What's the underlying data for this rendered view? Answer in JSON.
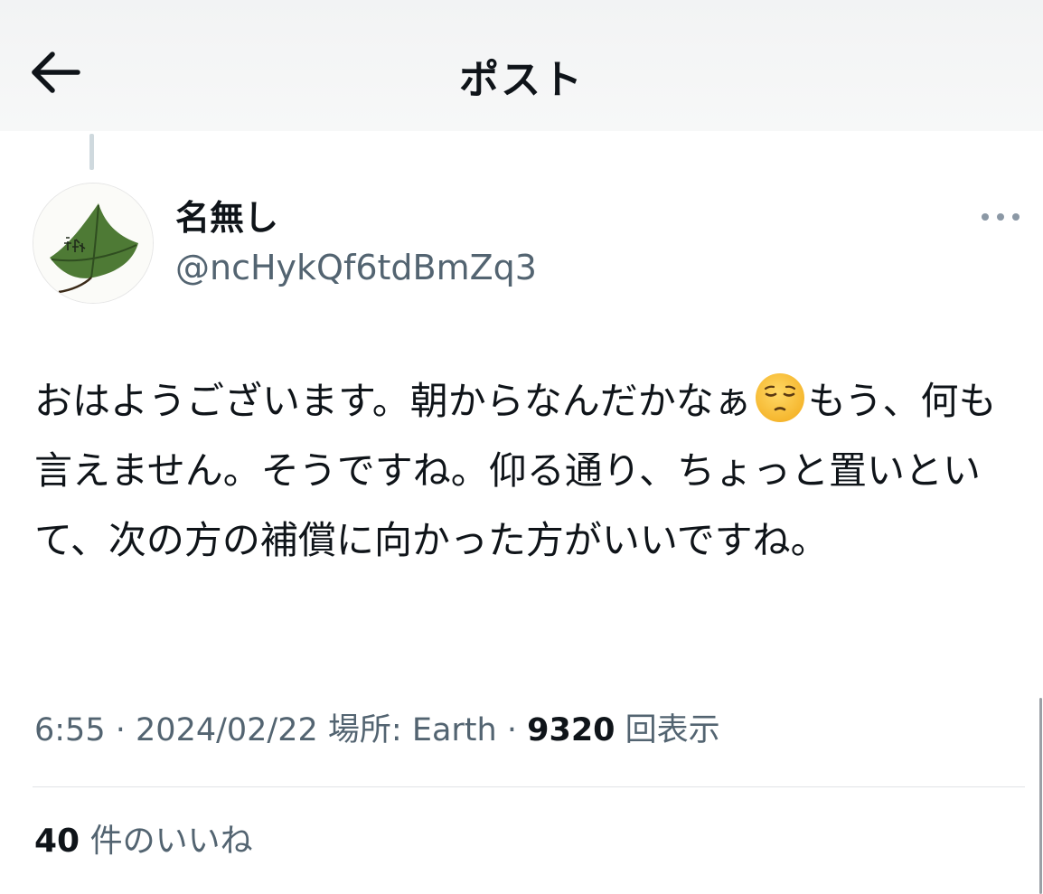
{
  "header": {
    "title": "ポスト",
    "back_icon": "arrow-left-icon"
  },
  "post": {
    "author": {
      "display_name": "名無し",
      "handle": "@ncHykQf6tdBmZq3"
    },
    "text_before_emoji": "おはようございます。朝からなんだかなぁ",
    "emoji": "pensive-face-emoji",
    "text_after_emoji": "もう、何も言えません。そうですね。仰る通り、ちょっと置いといて、次の方の補償に向かった方がいいですね。",
    "meta": {
      "time": "6:55",
      "separator": "·",
      "date": "2024/02/22",
      "location": "場所: Earth",
      "views_count": "9320",
      "views_label": "回表示"
    },
    "likes": {
      "count": "40",
      "label": "件のいいね"
    }
  },
  "colors": {
    "text_primary": "#0f1419",
    "text_secondary": "#536471",
    "divider": "#e1e4e6",
    "thread_line": "#cfd9de"
  }
}
